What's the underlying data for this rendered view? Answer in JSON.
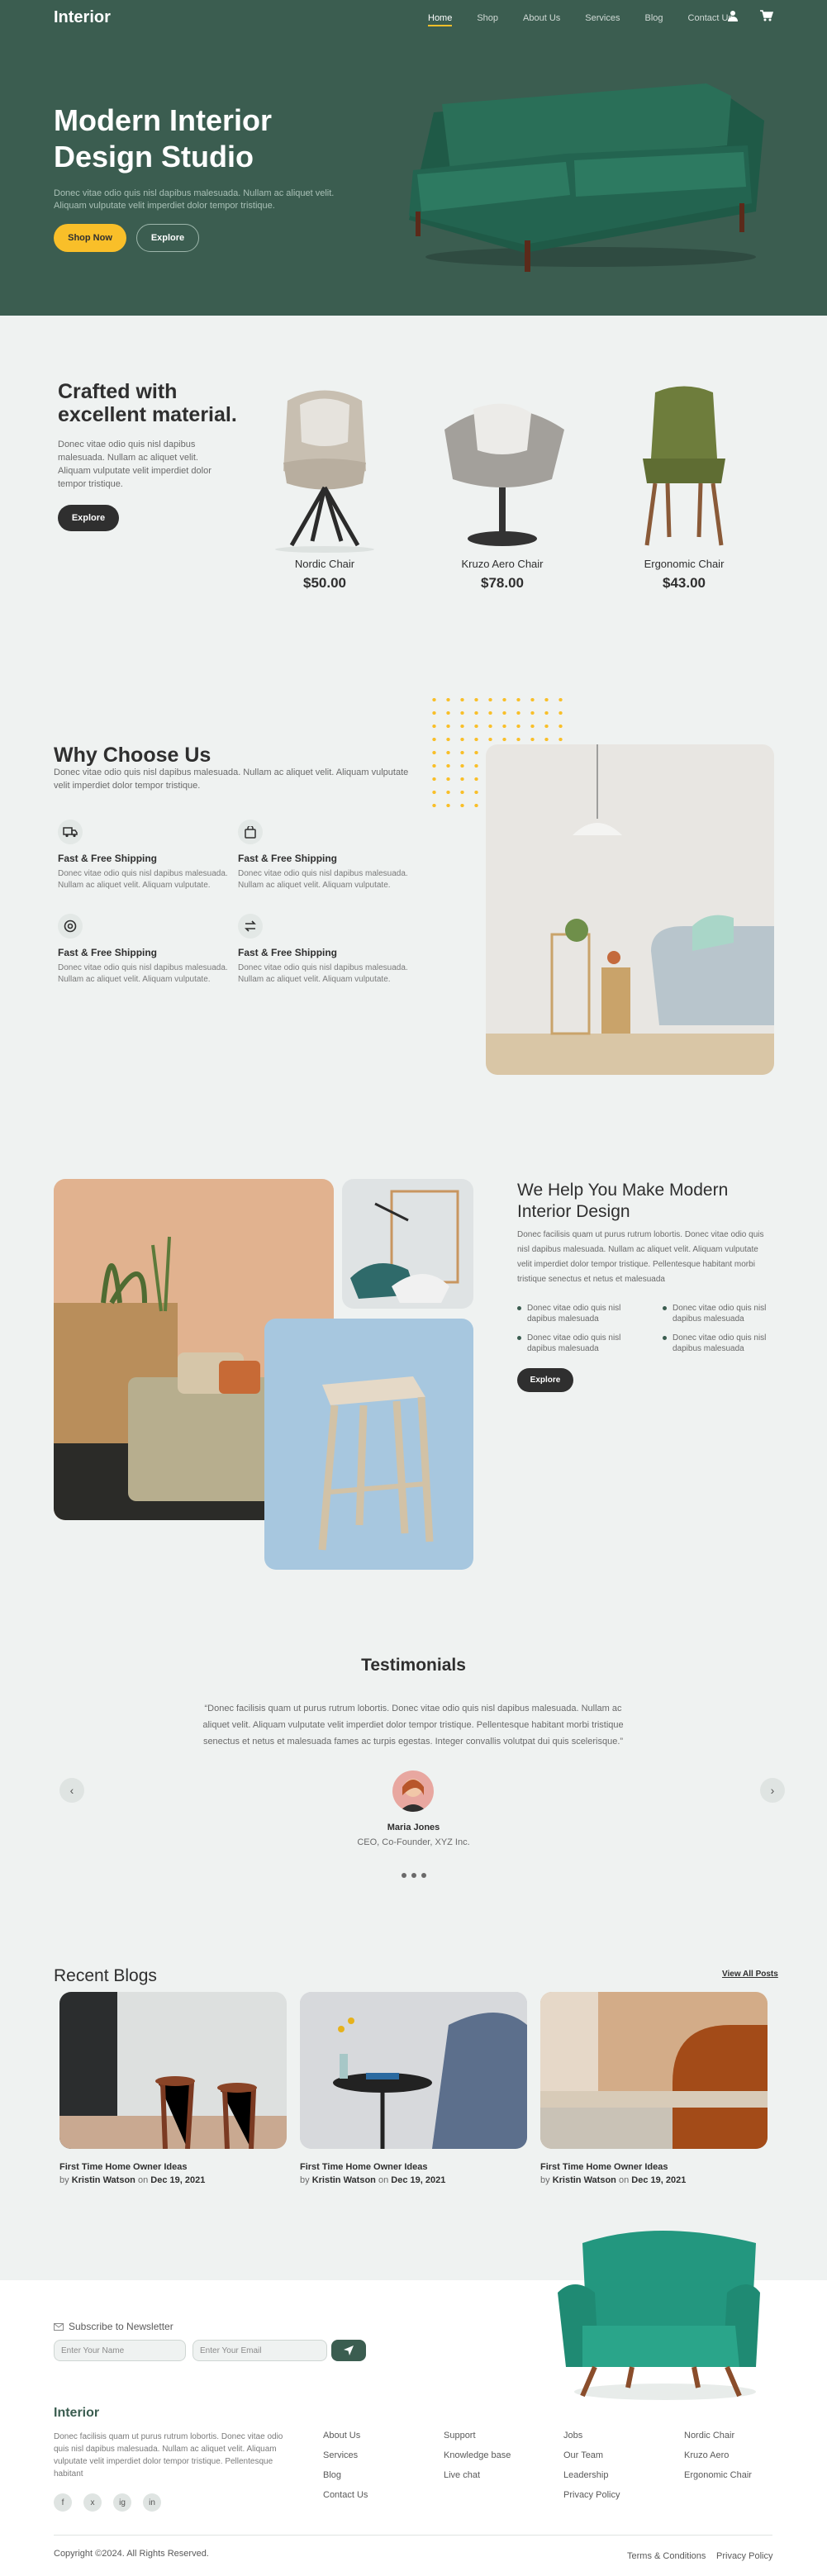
{
  "header": {
    "logo": "Interior",
    "nav": [
      "Home",
      "Shop",
      "About Us",
      "Services",
      "Blog",
      "Contact Us"
    ],
    "active_nav": "Home"
  },
  "hero": {
    "title": "Modern Interior Design Studio",
    "text": "Donec vitae odio quis nisl dapibus malesuada. Nullam ac aliquet velit. Aliquam vulputate velit imperdiet dolor tempor tristique.",
    "shop_label": "Shop Now",
    "explore_label": "Explore"
  },
  "products": {
    "title": "Crafted with excellent material.",
    "text": "Donec vitae odio quis nisl dapibus malesuada. Nullam ac aliquet velit. Aliquam vulputate velit imperdiet dolor tempor tristique.",
    "button": "Explore",
    "items": [
      {
        "name": "Nordic Chair",
        "price": "$50.00"
      },
      {
        "name": "Kruzo Aero Chair",
        "price": "$78.00"
      },
      {
        "name": "Ergonomic Chair",
        "price": "$43.00"
      }
    ]
  },
  "why": {
    "title": "Why Choose Us",
    "text": "Donec vitae odio quis nisl dapibus malesuada. Nullam ac aliquet velit. Aliquam vulputate velit imperdiet dolor tempor tristique.",
    "features": [
      {
        "icon": "truck-icon",
        "title": "Fast & Free Shipping",
        "text": "Donec vitae odio quis nisl dapibus malesuada. Nullam ac aliquet velit. Aliquam vulputate."
      },
      {
        "icon": "bag-icon",
        "title": "Fast & Free Shipping",
        "text": "Donec vitae odio quis nisl dapibus malesuada. Nullam ac aliquet velit. Aliquam vulputate."
      },
      {
        "icon": "support-icon",
        "title": "Fast & Free Shipping",
        "text": "Donec vitae odio quis nisl dapibus malesuada. Nullam ac aliquet velit. Aliquam vulputate."
      },
      {
        "icon": "return-icon",
        "title": "Fast & Free Shipping",
        "text": "Donec vitae odio quis nisl dapibus malesuada. Nullam ac aliquet velit. Aliquam vulputate."
      }
    ]
  },
  "help": {
    "title": "We Help You Make Modern Interior Design",
    "text": "Donec facilisis quam ut purus rutrum lobortis. Donec vitae odio quis nisl dapibus malesuada. Nullam ac aliquet velit. Aliquam vulputate velit imperdiet dolor tempor tristique. Pellentesque habitant morbi tristique senectus et netus et malesuada",
    "bullets": [
      "Donec vitae odio quis nisl dapibus malesuada",
      "Donec vitae odio quis nisl dapibus malesuada",
      "Donec vitae odio quis nisl dapibus malesuada",
      "Donec vitae odio quis nisl dapibus malesuada"
    ],
    "button": "Explore"
  },
  "testimonials": {
    "title": "Testimonials",
    "quote": "“Donec facilisis quam ut purus rutrum lobortis. Donec vitae odio quis nisl dapibus malesuada. Nullam ac aliquet velit. Aliquam vulputate velit imperdiet dolor tempor tristique. Pellentesque habitant morbi tristique senectus et netus et malesuada fames ac turpis egestas. Integer convallis volutpat dui quis scelerisque.”",
    "name": "Maria Jones",
    "role": "CEO, Co-Founder, XYZ Inc."
  },
  "blogs": {
    "title": "Recent Blogs",
    "view_all": "View All Posts",
    "items": [
      {
        "title": "First Time Home Owner Ideas",
        "by": "by",
        "author": "Kristin Watson",
        "on": "on",
        "date": "Dec 19, 2021"
      },
      {
        "title": "First Time Home Owner Ideas",
        "by": "by",
        "author": "Kristin Watson",
        "on": "on",
        "date": "Dec 19, 2021"
      },
      {
        "title": "First Time Home Owner Ideas",
        "by": "by",
        "author": "Kristin Watson",
        "on": "on",
        "date": "Dec 19, 2021"
      }
    ]
  },
  "footer": {
    "newsletter_label": "Subscribe to Newsletter",
    "name_placeholder": "Enter Your Name",
    "email_placeholder": "Enter Your Email",
    "logo": "Interior",
    "about": "Donec facilisis quam ut purus rutrum lobortis. Donec vitae odio quis nisl dapibus malesuada. Nullam ac aliquet velit. Aliquam vulputate velit imperdiet dolor tempor tristique. Pellentesque habitant",
    "social": [
      "f",
      "x",
      "ig",
      "in"
    ],
    "col1": [
      "About Us",
      "Services",
      "Blog",
      "Contact Us"
    ],
    "col2": [
      "Support",
      "Knowledge base",
      "Live chat"
    ],
    "col3": [
      "Jobs",
      "Our Team",
      "Leadership",
      "Privacy Policy"
    ],
    "col4": [
      "Nordic Chair",
      "Kruzo Aero",
      "Ergonomic Chair"
    ],
    "copyright": "Copyright ©2024. All Rights Reserved.",
    "terms": "Terms & Conditions",
    "privacy": "Privacy Policy"
  },
  "colors": {
    "primary": "#3b5d50",
    "accent": "#f9bf29",
    "background": "#eff2f1",
    "dark": "#2f2f2f"
  }
}
